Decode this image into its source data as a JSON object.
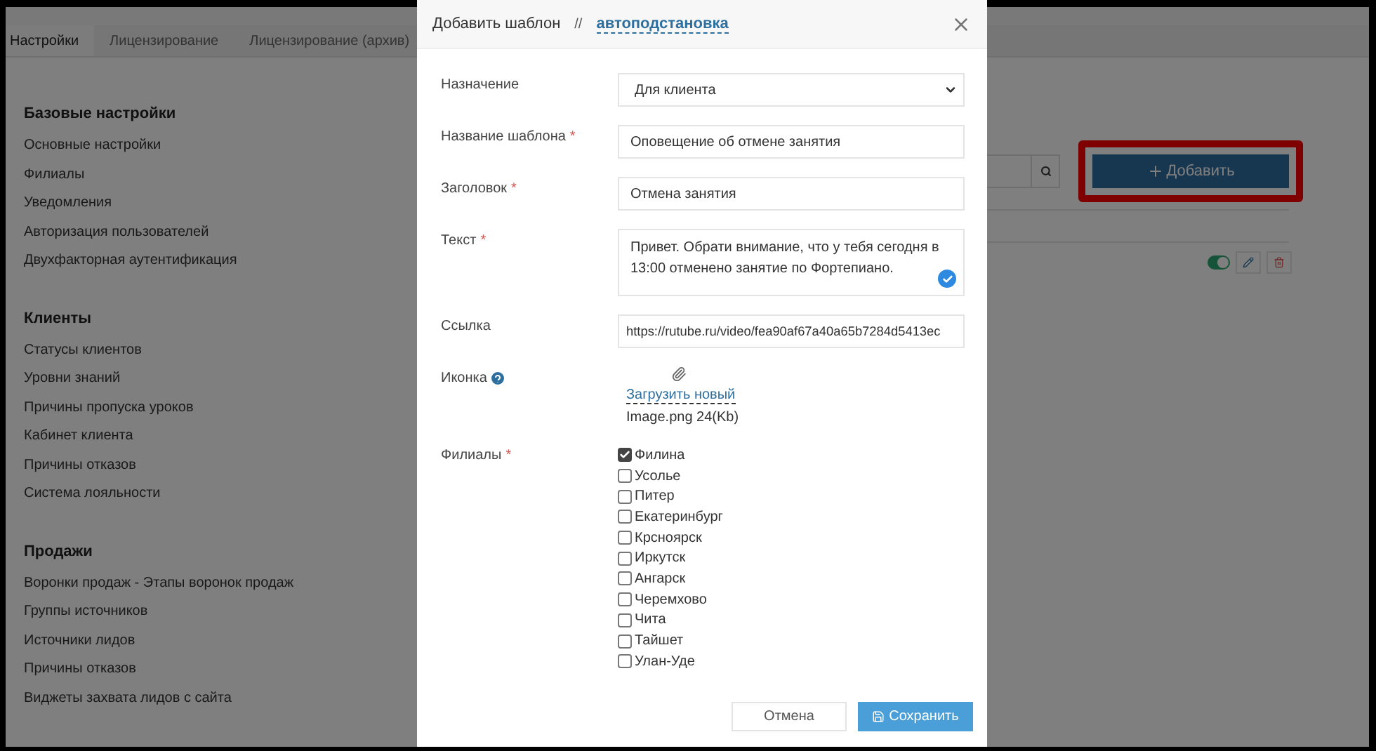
{
  "tabs": [
    {
      "label": "Настройки",
      "selected": true
    },
    {
      "label": "Лицензирование",
      "selected": false
    },
    {
      "label": "Лицензирование (архив)",
      "selected": false
    }
  ],
  "sidebar": {
    "sections": [
      {
        "title": "Базовые настройки",
        "items": [
          "Основные настройки",
          "Филиалы",
          "Уведомления",
          "Авторизация пользователей",
          "Двухфакторная аутентификация"
        ]
      },
      {
        "title": "Клиенты",
        "items": [
          "Статусы клиентов",
          "Уровни знаний",
          "Причины пропуска уроков",
          "Кабинет клиента",
          "Причины отказов",
          "Система лояльности"
        ]
      },
      {
        "title": "Продажи",
        "items": [
          "Воронки продаж - Этапы воронок продаж",
          "Группы источников",
          "Источники лидов",
          "Причины отказов",
          "Виджеты захвата лидов с сайта"
        ]
      }
    ]
  },
  "toolbar": {
    "add_button": {
      "label": "Добавить",
      "highlighted": true
    }
  },
  "template_row": {
    "enabled": true
  },
  "modal": {
    "required_mark": "*",
    "title": "Добавить шаблон",
    "separator": "//",
    "link": "автоподстановка",
    "fields": [
      {
        "kind": "select",
        "label": "Назначение",
        "required": false,
        "value": "Для клиента"
      },
      {
        "kind": "text",
        "label": "Название шаблона",
        "required": true,
        "value": "Оповещение об отмене занятия"
      },
      {
        "kind": "text",
        "label": "Заголовок",
        "required": true,
        "value": "Отмена занятия"
      },
      {
        "kind": "textarea",
        "label": "Текст",
        "required": true,
        "value": "Привет. Обрати внимание, что у тебя сегодня в 13:00 отменено занятие по Фортепиано."
      },
      {
        "kind": "text",
        "label": "Ссылка",
        "required": false,
        "value": "https://rutube.ru/video/fea90af67a40a65b7284d5413ec"
      },
      {
        "kind": "upload",
        "label": "Иконка",
        "required": false,
        "help": true,
        "link": "Загрузить новый",
        "file": "Image.png 24(Kb)"
      },
      {
        "kind": "checkboxes",
        "label": "Филиалы",
        "required": true,
        "options": [
          {
            "label": "Филина",
            "checked": true
          },
          {
            "label": "Усолье",
            "checked": false
          },
          {
            "label": "Питер",
            "checked": false
          },
          {
            "label": "Екатеринбург",
            "checked": false
          },
          {
            "label": "Крсноярск",
            "checked": false
          },
          {
            "label": "Иркутск",
            "checked": false
          },
          {
            "label": "Ангарск",
            "checked": false
          },
          {
            "label": "Черемхово",
            "checked": false
          },
          {
            "label": "Чита",
            "checked": false
          },
          {
            "label": "Тайшет",
            "checked": false
          },
          {
            "label": "Улан-Уде",
            "checked": false
          }
        ]
      }
    ],
    "buttons": [
      {
        "kind": "cancel",
        "label": "Отмена"
      },
      {
        "kind": "save",
        "label": "Сохранить"
      }
    ]
  }
}
